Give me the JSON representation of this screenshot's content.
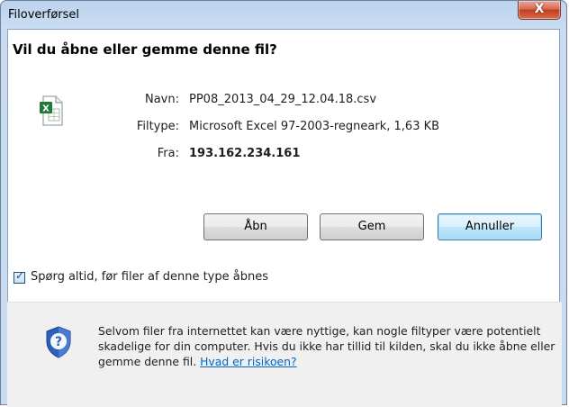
{
  "window": {
    "title": "Filoverførsel",
    "close_label": "X"
  },
  "dialog": {
    "question": "Vil du åbne eller gemme denne fil?",
    "file_icon": "excel-file-icon",
    "fields": {
      "name_label": "Navn:",
      "name_value": "PP08_2013_04_29_12.04.18.csv",
      "type_label": "Filtype:",
      "type_value": "Microsoft Excel 97-2003-regneark, 1,63 KB",
      "from_label": "Fra:",
      "from_value": "193.162.234.161"
    },
    "buttons": {
      "open_label": "Åbn",
      "save_label": "Gem",
      "cancel_label": "Annuller"
    },
    "checkbox": {
      "checked": true,
      "label": "Spørg altid, før filer af denne type åbnes"
    }
  },
  "footer": {
    "icon": "security-shield-icon",
    "text": "Selvom filer fra internettet kan være nyttige, kan nogle filtyper være potentielt skadelige for din computer. Hvis du ikke har tillid til kilden, skal du ikke åbne eller gemme denne fil.",
    "link": "Hvad er risikoen?"
  },
  "colors": {
    "link": "#0066cc",
    "frame": "#c7dbf1",
    "close": "#c23d1f"
  }
}
